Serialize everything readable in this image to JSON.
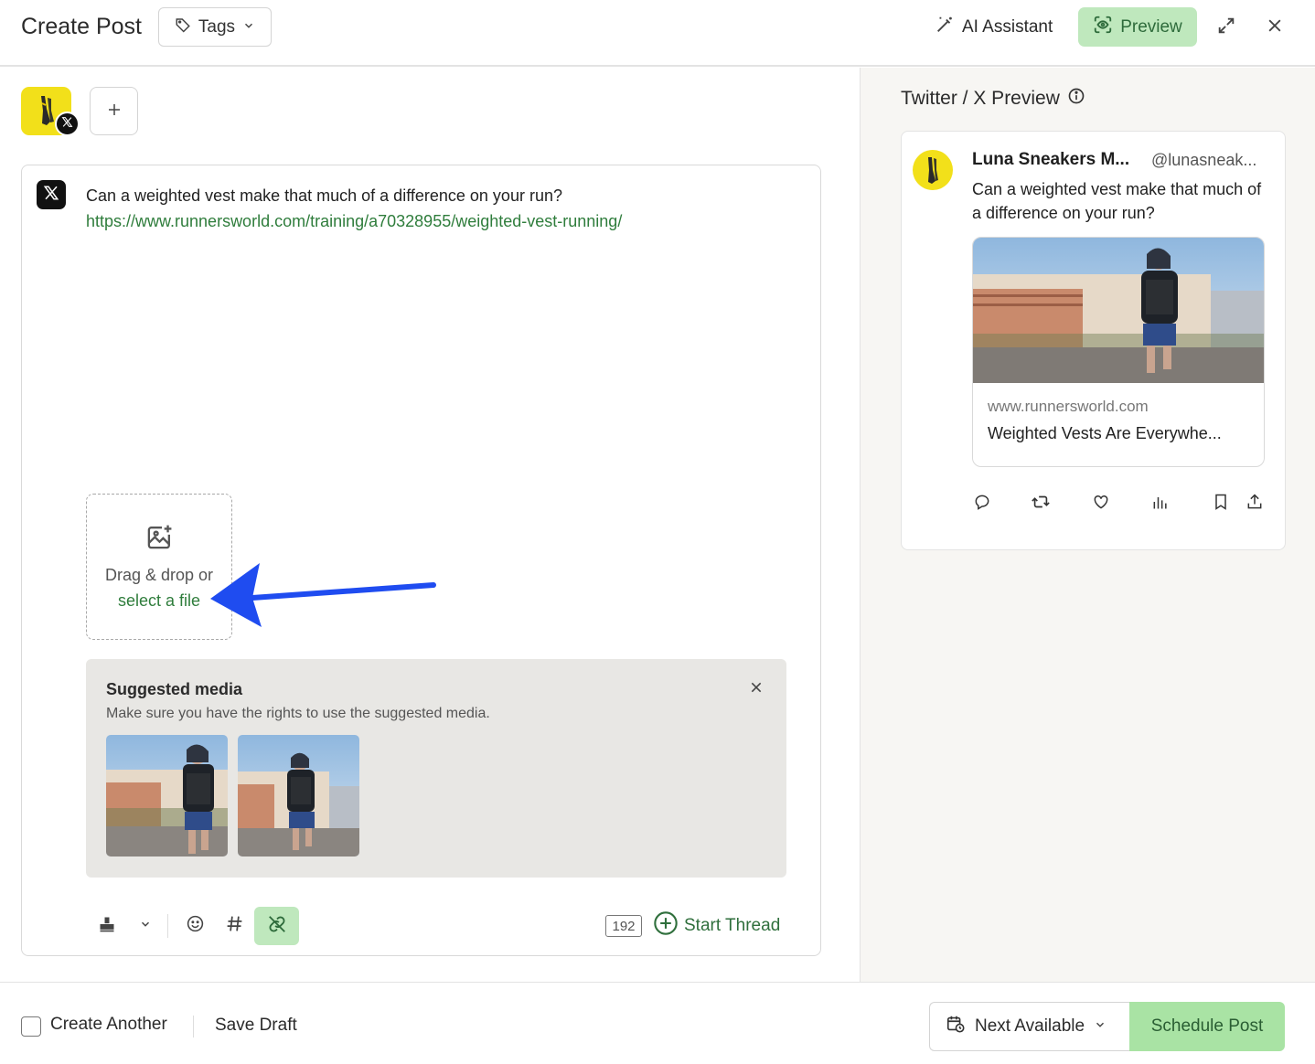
{
  "header": {
    "title": "Create Post",
    "tags_label": "Tags",
    "ai_assistant_label": "AI Assistant",
    "preview_label": "Preview"
  },
  "editor": {
    "post_text": "Can a weighted vest make that much of a difference on your run?",
    "post_link": "https://www.runnersworld.com/training/a70328955/weighted-vest-running/",
    "dropzone_text": "Drag & drop or",
    "dropzone_link": "select a file",
    "char_count": "192",
    "start_thread_label": "Start Thread"
  },
  "suggested_media": {
    "title": "Suggested media",
    "subtitle": "Make sure you have the rights to use the suggested media."
  },
  "preview": {
    "title": "Twitter / X Preview",
    "name": "Luna Sneakers M...",
    "handle": "@lunasneak...",
    "text": "Can a weighted vest make that much of a difference on your run?",
    "link_domain": "www.runnersworld.com",
    "link_title": "Weighted Vests Are Everywhe..."
  },
  "footer": {
    "create_another_label": "Create Another",
    "create_another_checked": false,
    "save_draft_label": "Save Draft",
    "schedule_option": "Next Available",
    "schedule_button": "Schedule Post"
  },
  "colors": {
    "accent_green": "#2f7d3c",
    "preview_button_bg": "#bfe8bd",
    "schedule_button_bg": "#a9e3a4",
    "annotation_arrow": "#1f4cf0",
    "brand_yellow": "#f2e01a"
  },
  "icons": [
    "tag-icon",
    "magic-wand-icon",
    "eye-scan-icon",
    "expand-icon",
    "close-icon",
    "x-logo-icon",
    "plus-icon",
    "image-add-icon",
    "stamp-icon",
    "chevron-down-icon",
    "emoji-icon",
    "hashtag-icon",
    "link-off-icon",
    "plus-circle-icon",
    "info-icon",
    "reply-icon",
    "retweet-icon",
    "like-icon",
    "views-icon",
    "bookmark-icon",
    "share-icon",
    "calendar-clock-icon"
  ]
}
